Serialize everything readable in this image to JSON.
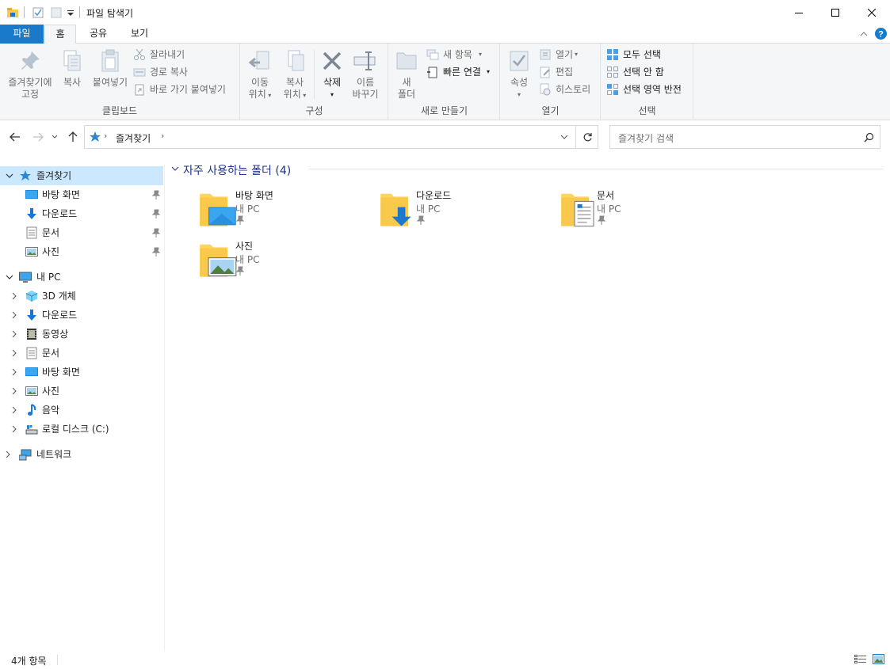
{
  "window": {
    "title": "파일 탐색기",
    "colors": {
      "accent": "#1979ca",
      "selection": "#cce8ff",
      "folder": "#ffd45c",
      "header_text": "#1e3287"
    }
  },
  "tabs": [
    {
      "label": "파일"
    },
    {
      "label": "홈"
    },
    {
      "label": "공유"
    },
    {
      "label": "보기"
    }
  ],
  "ribbon": {
    "clipboard": {
      "label": "클립보드",
      "pin_line1": "즐겨찾기에",
      "pin_line2": "고정",
      "copy": "복사",
      "paste": "붙여넣기",
      "cut": "잘라내기",
      "copy_path": "경로 복사",
      "paste_shortcut": "바로 가기 붙여넣기"
    },
    "organize": {
      "label": "구성",
      "move_line1": "이동",
      "move_line2": "위치",
      "copy_line1": "복사",
      "copy_line2": "위치",
      "delete": "삭제",
      "rename_line1": "이름",
      "rename_line2": "바꾸기"
    },
    "new": {
      "label": "새로 만들기",
      "folder_line1": "새",
      "folder_line2": "폴더",
      "new_item": "새 항목",
      "easy_access": "빠른 연결"
    },
    "open": {
      "label": "열기",
      "properties": "속성",
      "open": "열기",
      "edit": "편집",
      "history": "히스토리"
    },
    "select": {
      "label": "선택",
      "select_all": "모두 선택",
      "select_none": "선택 안 함",
      "invert": "선택 영역 반전"
    }
  },
  "address": {
    "path": "즐겨찾기",
    "search_placeholder": "즐겨찾기 검색"
  },
  "navpane": {
    "quick_access": "즐겨찾기",
    "quick_items": [
      {
        "label": "바탕 화면",
        "icon": "desktop-icon"
      },
      {
        "label": "다운로드",
        "icon": "download-icon"
      },
      {
        "label": "문서",
        "icon": "document-icon"
      },
      {
        "label": "사진",
        "icon": "picture-icon"
      }
    ],
    "this_pc": "내 PC",
    "pc_items": [
      {
        "label": "3D 개체",
        "icon": "3d-objects-icon"
      },
      {
        "label": "다운로드",
        "icon": "download-icon"
      },
      {
        "label": "동영상",
        "icon": "video-icon"
      },
      {
        "label": "문서",
        "icon": "document-icon"
      },
      {
        "label": "바탕 화면",
        "icon": "desktop-icon"
      },
      {
        "label": "사진",
        "icon": "picture-icon"
      },
      {
        "label": "음악",
        "icon": "music-icon"
      },
      {
        "label": "로컬 디스크 (C:)",
        "icon": "drive-icon"
      }
    ],
    "network": "네트워크"
  },
  "content": {
    "section_title": "자주 사용하는 폴더 (4)",
    "folders": [
      {
        "name": "바탕 화면",
        "location": "내 PC"
      },
      {
        "name": "다운로드",
        "location": "내 PC"
      },
      {
        "name": "문서",
        "location": "내 PC"
      },
      {
        "name": "사진",
        "location": "내 PC"
      }
    ]
  },
  "status": {
    "item_count": "4개 항목"
  }
}
